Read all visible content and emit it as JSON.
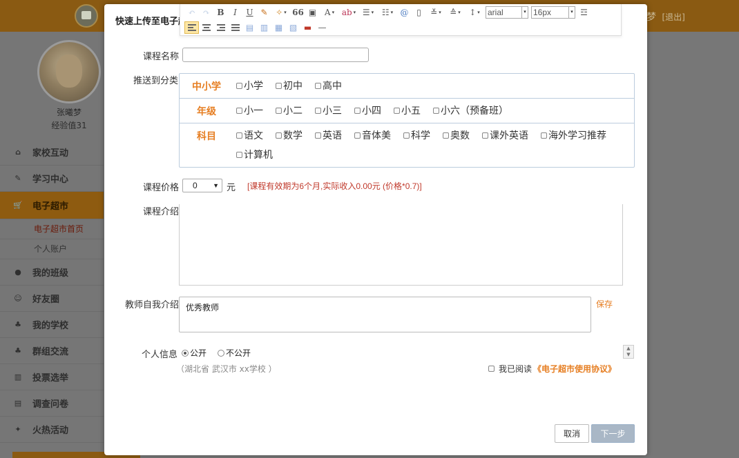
{
  "colors": {
    "accent": "#e67e22",
    "header_bg": "#8a5a12",
    "note_red": "#c0392b",
    "next_btn": "#a9b7c6"
  },
  "header": {
    "user_name_partial": "梦",
    "logout_label": "[退出]"
  },
  "profile": {
    "name": "张曦梦",
    "exp": "经验值31"
  },
  "sidebar": {
    "items": [
      {
        "label": "家校互动",
        "icon": "home-icon",
        "glyph": "⌂"
      },
      {
        "label": "学习中心",
        "icon": "edit-icon",
        "glyph": "✎"
      },
      {
        "label": "电子超市",
        "icon": "cart-icon",
        "glyph": "🛒",
        "active": true
      },
      {
        "label": "我的班级",
        "icon": "user-icon",
        "glyph": "●"
      },
      {
        "label": "好友圈",
        "icon": "smile-icon",
        "glyph": "☺"
      },
      {
        "label": "我的学校",
        "icon": "sitemap-icon",
        "glyph": "♣"
      },
      {
        "label": "群组交流",
        "icon": "group-icon",
        "glyph": "♣"
      },
      {
        "label": "投票选举",
        "icon": "chart-icon",
        "glyph": "▥"
      },
      {
        "label": "调查问卷",
        "icon": "file-icon",
        "glyph": "▤"
      },
      {
        "label": "火热活动",
        "icon": "fire-icon",
        "glyph": "✦"
      }
    ],
    "sub_items": [
      "电子超市首页",
      "个人账户"
    ]
  },
  "modal": {
    "title": "快速上传至电子超市",
    "toolbar": {
      "font_family": "arial",
      "font_size": "16px",
      "bold": "B",
      "italic": "I",
      "underline": "U",
      "quote": "66",
      "font_color": "A",
      "hr": "—"
    },
    "form": {
      "course_name_label": "课程名称",
      "course_name_value": "",
      "category_label": "推送到分类",
      "categories": [
        {
          "head": "中小学",
          "options": [
            "小学",
            "初中",
            "高中"
          ]
        },
        {
          "head": "年级",
          "options": [
            "小一",
            "小二",
            "小三",
            "小四",
            "小五",
            "小六（预备班）"
          ]
        },
        {
          "head": "科目",
          "options": [
            "语文",
            "数学",
            "英语",
            "音体美",
            "科学",
            "奥数",
            "课外英语",
            "海外学习推荐",
            "计算机"
          ]
        }
      ],
      "price_label": "课程价格",
      "price_value": "0",
      "price_unit": "元",
      "price_note": "[课程有效期为6个月,实际收入0.00元 (价格*0.7)]",
      "intro_label": "课程介绍",
      "teacher_intro_label": "教师自我介绍",
      "teacher_intro_value": "优秀教师",
      "save_label": "保存",
      "personal_info_label": "个人信息",
      "public_label": "公开",
      "private_label": "不公开",
      "school_info": "（湖北省 武汉市 xx学校 ）",
      "agree_text": "我已阅读",
      "agreement_link": "《电子超市使用协议》",
      "cancel_label": "取消",
      "next_label": "下一步"
    }
  }
}
